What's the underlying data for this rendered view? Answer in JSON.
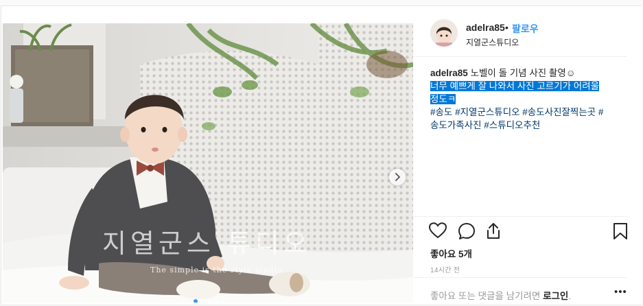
{
  "post": {
    "username": "adelra85",
    "separator": "•",
    "follow_label": "팔로우",
    "location": "지열군스튜디오",
    "caption": {
      "username": "adelra85",
      "line1": "노벨이 돌 기념 사진 촬영☺",
      "highlighted_1": "너무 예쁘게 잘 나와서 사진 고르기가 어려울",
      "highlighted_2": "정도ㅋ",
      "hashtags_1": "#송도 #지열군스튜디오 #송도사진잘찍는곳 #",
      "hashtags_2": "송도가족사진 #스튜디오추천"
    },
    "likes": "좋아요 5개",
    "time": "14시간 전",
    "comment_prompt": "좋아요 또는 댓글을 남기려면",
    "login_label": "로그인",
    "period": ".",
    "more_label": "•••"
  },
  "photo": {
    "watermark": "지열군스 튜디오",
    "watermark_sub": "The simple is the style studio",
    "carousel_dots": 5,
    "active_dot": 0
  },
  "icons": [
    "heart-icon",
    "comment-icon",
    "share-icon",
    "bookmark-icon",
    "chevron-right-icon"
  ],
  "colors": {
    "link": "#3897f0",
    "selection": "#0078d7",
    "hashtag": "#003569",
    "muted": "#999999"
  }
}
